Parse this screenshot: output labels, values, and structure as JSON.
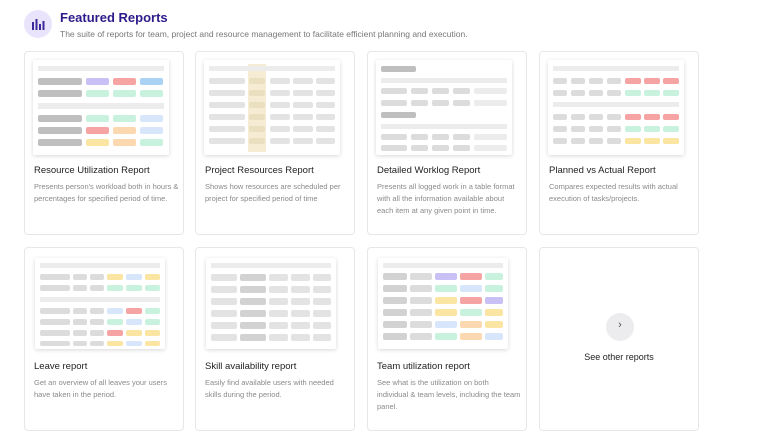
{
  "header": {
    "icon": "bar-chart-icon",
    "title": "Featured Reports",
    "subtitle": "The suite of reports for team, project and resource management to facilitate efficient planning and execution."
  },
  "colors": {
    "accent": "#2e1a8a",
    "icon_bg": "#e9e4fb",
    "thumb_gray": "#d2d2d2",
    "thumb_light": "#ececec",
    "purple": "#c9c0f5",
    "red": "#f5a3a3",
    "blue": "#a9d2f5",
    "green": "#c8f1de",
    "yellow": "#fbe5a3",
    "orange": "#fcd8b0",
    "lightblue": "#d8e6fb",
    "beige": "#f5ecd3"
  },
  "cards": [
    {
      "title": "Resource Utilization Report",
      "desc": "Presents person's workload both in hours & percentages for specified period of time."
    },
    {
      "title": "Project Resources Report",
      "desc": "Shows how resources are scheduled per project for specified period of time"
    },
    {
      "title": "Detailed Worklog Report",
      "desc": "Presents all logged work in a table format with all the information available about each item at any given point in time."
    },
    {
      "title": "Planned vs Actual Report",
      "desc": "Compares expected results with actual execution of tasks/projects."
    },
    {
      "title": "Leave report",
      "desc": "Get an overview of all leaves your users have taken in the period."
    },
    {
      "title": "Skill availability report",
      "desc": "Easily find available users with needed skills during the period."
    },
    {
      "title": "Team utilization report",
      "desc": "See what is the utilization on both individual & team levels, including the team panel."
    }
  ],
  "see_other": {
    "icon": "chevron-right-icon",
    "label": "See other reports"
  }
}
